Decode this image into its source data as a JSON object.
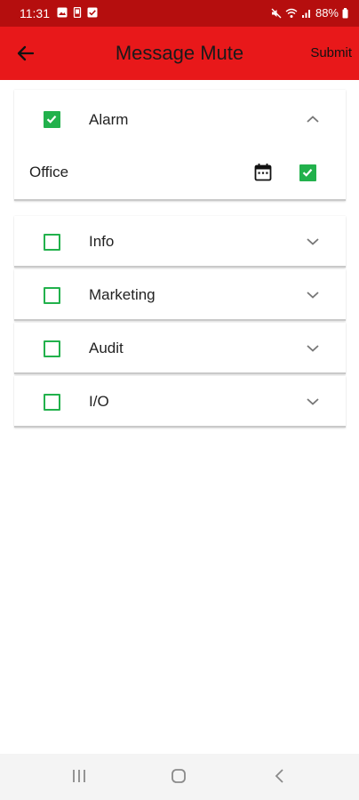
{
  "status": {
    "time": "11:31",
    "battery": "88%"
  },
  "header": {
    "title": "Message Mute",
    "submit_label": "Submit"
  },
  "categories": [
    {
      "label": "Alarm",
      "checked": true,
      "expanded": true,
      "sub": [
        {
          "label": "Office",
          "checked": true
        }
      ]
    },
    {
      "label": "Info",
      "checked": false,
      "expanded": false
    },
    {
      "label": "Marketing",
      "checked": false,
      "expanded": false
    },
    {
      "label": "Audit",
      "checked": false,
      "expanded": false
    },
    {
      "label": "I/O",
      "checked": false,
      "expanded": false
    }
  ],
  "colors": {
    "status_bar": "#b50e0e",
    "app_bar": "#e8181a",
    "checkbox_green": "#22b14c",
    "nav_bar": "#f4f4f4"
  },
  "icons": {
    "back": "arrow-left-icon",
    "expand": "chevron-down-icon",
    "collapse": "chevron-up-icon",
    "calendar": "calendar-icon",
    "nav_recents": "recents-icon",
    "nav_home": "home-icon",
    "nav_back": "back-nav-icon"
  }
}
